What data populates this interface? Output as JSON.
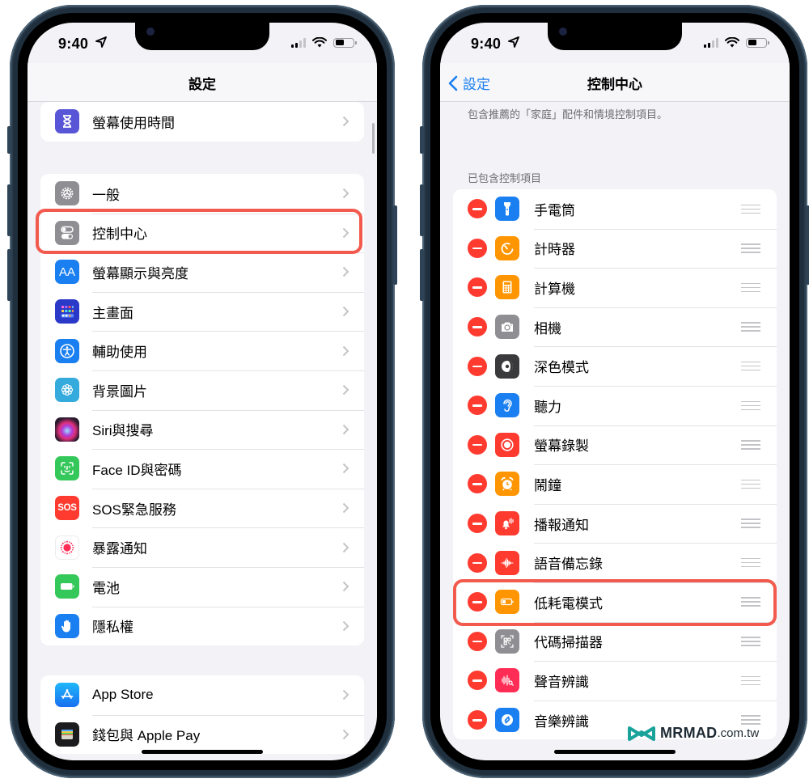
{
  "status_bar": {
    "time": "9:40",
    "signal_bars_active": 2,
    "signal_bars_total": 4,
    "battery_level": 0.5
  },
  "left_screen": {
    "nav_title": "設定",
    "groups": [
      {
        "items": [
          {
            "label": "螢幕使用時間",
            "icon": "hourglass-icon",
            "color": "#5856d6"
          }
        ]
      },
      {
        "items": [
          {
            "label": "一般",
            "icon": "gear-icon",
            "color": "#8e8e93"
          },
          {
            "label": "控制中心",
            "icon": "toggles-icon",
            "color": "#8e8e93",
            "highlighted": true
          },
          {
            "label": "螢幕顯示與亮度",
            "icon": "text-size-icon",
            "color": "#1a7ff0",
            "glyph": "AA"
          },
          {
            "label": "主畫面",
            "icon": "home-grid-icon",
            "color": "#2b39c9"
          },
          {
            "label": "輔助使用",
            "icon": "accessibility-icon",
            "color": "#1a7ff0"
          },
          {
            "label": "背景圖片",
            "icon": "flower-icon",
            "color": "#35aadc"
          },
          {
            "label": "Siri與搜尋",
            "icon": "siri-icon",
            "color": "#2a1a2e"
          },
          {
            "label": "Face ID與密碼",
            "icon": "face-id-icon",
            "color": "#34c759"
          },
          {
            "label": "SOS緊急服務",
            "icon": "sos-icon",
            "color": "#ff3b30",
            "glyph": "SOS"
          },
          {
            "label": "暴露通知",
            "icon": "exposure-icon",
            "color": "#ffffff"
          },
          {
            "label": "電池",
            "icon": "battery-icon",
            "color": "#34c759"
          },
          {
            "label": "隱私權",
            "icon": "hand-icon",
            "color": "#1a7ff0"
          }
        ]
      },
      {
        "items": [
          {
            "label": "App Store",
            "icon": "app-store-icon",
            "color": "#1a8cf5"
          },
          {
            "label": "錢包與 Apple Pay",
            "icon": "wallet-icon",
            "color": "#1c1c1e"
          }
        ]
      }
    ]
  },
  "right_screen": {
    "back_label": "設定",
    "nav_title": "控制中心",
    "description": "包含推薦的「家庭」配件和情境控制項目。",
    "section_header": "已包含控制項目",
    "controls": [
      {
        "label": "手電筒",
        "icon": "flashlight-icon",
        "color": "#1a7ff0"
      },
      {
        "label": "計時器",
        "icon": "timer-icon",
        "color": "#ff9500"
      },
      {
        "label": "計算機",
        "icon": "calculator-icon",
        "color": "#ff9500"
      },
      {
        "label": "相機",
        "icon": "camera-icon",
        "color": "#8e8e93"
      },
      {
        "label": "深色模式",
        "icon": "dark-mode-icon",
        "color": "#3a3a3c"
      },
      {
        "label": "聽力",
        "icon": "ear-icon",
        "color": "#1a7ff0"
      },
      {
        "label": "螢幕錄製",
        "icon": "record-icon",
        "color": "#ff3b30"
      },
      {
        "label": "鬧鐘",
        "icon": "alarm-clock-icon",
        "color": "#ff9500"
      },
      {
        "label": "播報通知",
        "icon": "announce-bell-icon",
        "color": "#ff3b30"
      },
      {
        "label": "語音備忘錄",
        "icon": "waveform-icon",
        "color": "#ff3b30"
      },
      {
        "label": "低耗電模式",
        "icon": "low-power-battery-icon",
        "color": "#ff9500",
        "highlighted": true
      },
      {
        "label": "代碼掃描器",
        "icon": "qr-scanner-icon",
        "color": "#8e8e93"
      },
      {
        "label": "聲音辨識",
        "icon": "sound-recognition-icon",
        "color": "#ff2d55"
      },
      {
        "label": "音樂辨識",
        "icon": "shazam-icon",
        "color": "#1a7ff0"
      }
    ]
  },
  "watermark": {
    "brand": "MRMAD",
    "tld": ".com.tw"
  },
  "colors": {
    "highlight": "#f25a4e",
    "remove": "#ff3b30",
    "link": "#1a7ff0"
  }
}
